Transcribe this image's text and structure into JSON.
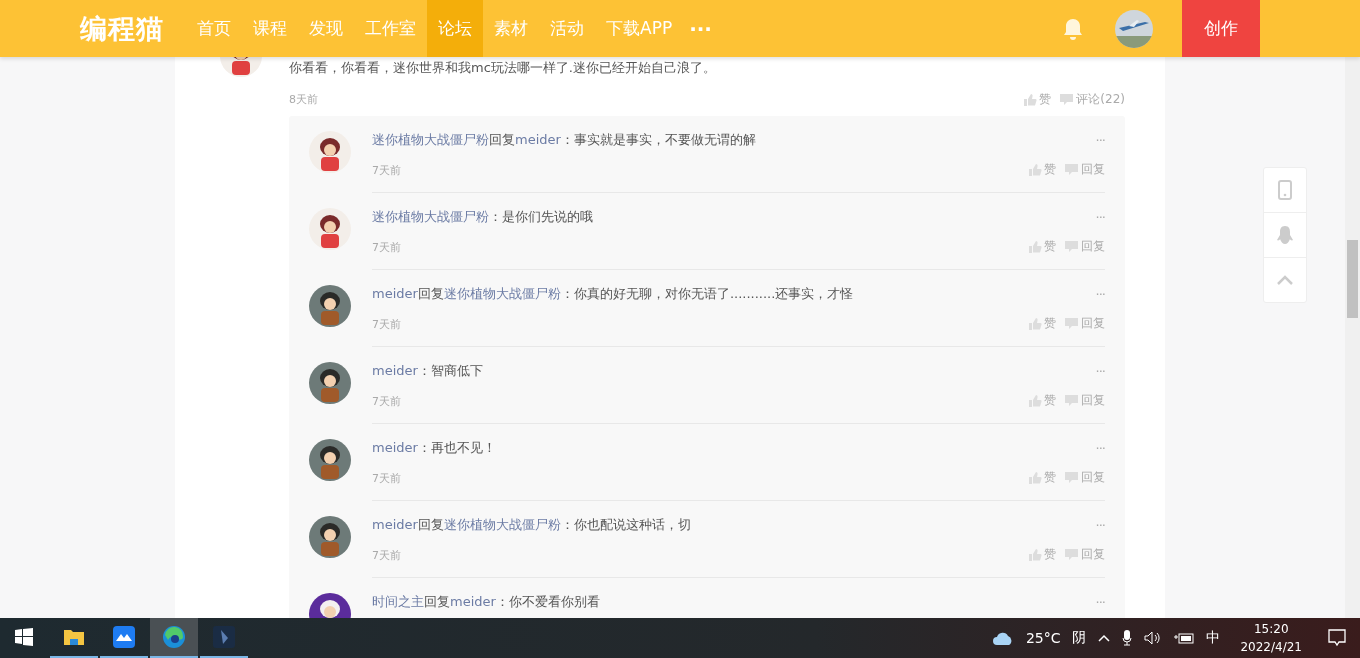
{
  "header": {
    "logo": "编程猫",
    "nav": [
      {
        "label": "首页",
        "selected": false
      },
      {
        "label": "课程",
        "selected": false
      },
      {
        "label": "发现",
        "selected": false
      },
      {
        "label": "工作室",
        "selected": false
      },
      {
        "label": "论坛",
        "selected": true
      },
      {
        "label": "素材",
        "selected": false
      },
      {
        "label": "活动",
        "selected": false
      },
      {
        "label": "下载APP",
        "selected": false
      }
    ],
    "more": "···",
    "create_button": "创作"
  },
  "comment": {
    "text": "你看看，你看看，迷你世界和我mc玩法哪一样了.迷你已经开始自己浪了。",
    "time": "8天前",
    "like": "赞",
    "comments": "评论(22)"
  },
  "replies": [
    {
      "author": "迷你植物大战僵尸粉",
      "verb": "回复",
      "target": "meider",
      "text": "：事实就是事实，不要做无谓的解",
      "time": "7天前",
      "like": "赞",
      "reply": "回复",
      "more": "···"
    },
    {
      "author": "迷你植物大战僵尸粉",
      "text": "：是你们先说的哦",
      "time": "7天前",
      "like": "赞",
      "reply": "回复",
      "more": "···"
    },
    {
      "author": "meider",
      "verb": "回复",
      "target": "迷你植物大战僵尸粉",
      "text": "：你真的好无聊，对你无语了...........还事实，才怪",
      "time": "7天前",
      "like": "赞",
      "reply": "回复",
      "more": "···"
    },
    {
      "author": "meider",
      "text": "：智商低下",
      "time": "7天前",
      "like": "赞",
      "reply": "回复",
      "more": "···"
    },
    {
      "author": "meider",
      "text": "：再也不见！",
      "time": "7天前",
      "like": "赞",
      "reply": "回复",
      "more": "···"
    },
    {
      "author": "meider",
      "verb": "回复",
      "target": "迷你植物大战僵尸粉",
      "text": "：你也配说这种话，切",
      "time": "7天前",
      "like": "赞",
      "reply": "回复",
      "more": "···"
    },
    {
      "author": "时间之主",
      "verb": "回复",
      "target": "meider",
      "text": "：你不爱看你别看",
      "more": "···"
    }
  ],
  "taskbar": {
    "apps": [
      {
        "kind": "folder",
        "running": true,
        "selected": false
      },
      {
        "kind": "blue",
        "running": true,
        "selected": false
      },
      {
        "kind": "edge",
        "running": true,
        "selected": true
      },
      {
        "kind": "dark",
        "running": true,
        "selected": false
      }
    ],
    "temperature": "25°C",
    "weather": "阴",
    "ime": "中",
    "time": "15:20",
    "date": "2022/4/21"
  }
}
